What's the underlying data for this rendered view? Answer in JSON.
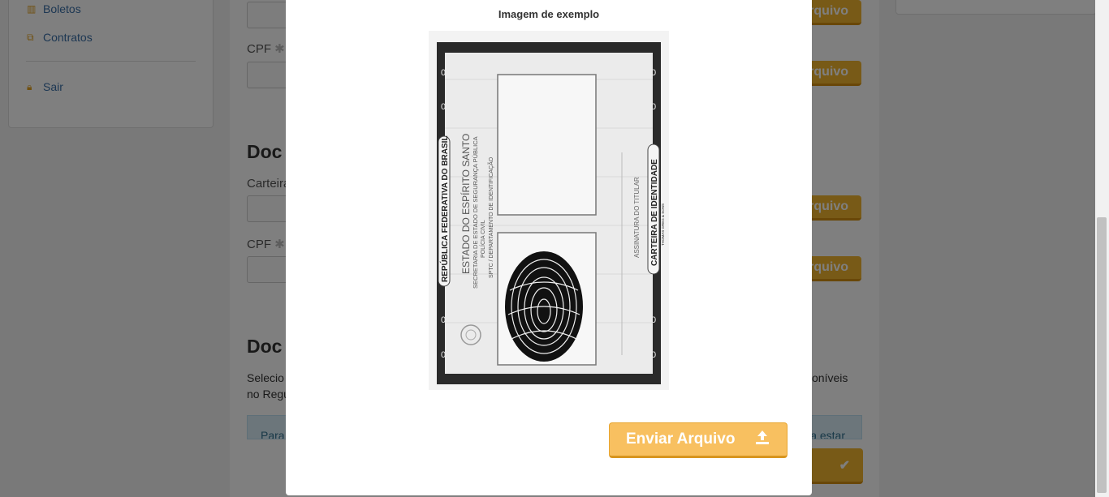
{
  "sidebar": {
    "items": [
      {
        "label": "Boletos",
        "icon": "barcode-icon"
      },
      {
        "label": "Contratos",
        "icon": "copy-icon"
      },
      {
        "label": "Sair",
        "icon": "lock-icon"
      }
    ]
  },
  "form": {
    "cpf_label_1": "CPF",
    "heading_1": "Doc",
    "carteira_label": "Carteira",
    "cpf_label_2": "CPF",
    "heading_2": "Doc",
    "para_line_1_start": "Selecio",
    "para_line_1_end": "oníveis",
    "para_line_2": "no Regu",
    "info_start": "Para",
    "info_end": "a estar",
    "btn_partial": "rquivo",
    "asterisk": "✱"
  },
  "modal": {
    "title": "Imagem de exemplo",
    "send_button_label": "Enviar Arquivo",
    "send_icon": "upload-icon"
  },
  "id_card": {
    "country": "REPÚBLICA FEDERATIVA DO BRASIL",
    "state": "ESTADO DO ESPÍRITO SANTO",
    "secretariat": "SECRETARIA DE ESTADO DE SEGURANÇA PÚBLICA",
    "police": "POLÍCIA CIVIL",
    "department": "SPTC / DEPARTAMENTO DE IDENTIFICAÇÃO",
    "signature": "ASSINATURA DO TITULAR",
    "card_name": "CARTEIRA DE IDENTIDADE",
    "printer": "THOMAS GREG & SONS",
    "margin_digit": "0"
  },
  "colors": {
    "accent": "#f0b42f",
    "accent_light": "#f8c060",
    "link": "#3a6fa6"
  }
}
